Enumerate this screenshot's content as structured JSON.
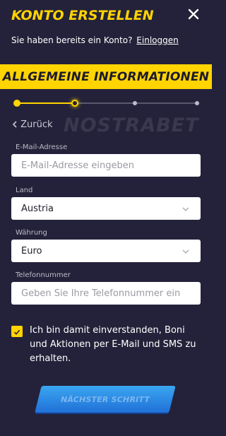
{
  "header": {
    "title": "KONTO ERSTELLEN",
    "subtitle": "Sie haben bereits ein Konto?",
    "login_link": "Einloggen"
  },
  "banner": {
    "title": "ALLGEMEINE INFORMATIONEN"
  },
  "stepper": {
    "steps": 4,
    "current_step": 2
  },
  "nav": {
    "back_label": "Zurück"
  },
  "watermark": "NOSTRABET",
  "form": {
    "email": {
      "label": "E-Mail-Adresse",
      "value": "",
      "placeholder": "E-Mail-Adresse eingeben"
    },
    "country": {
      "label": "Land",
      "value": "Austria"
    },
    "currency": {
      "label": "Währung",
      "value": "Euro"
    },
    "phone": {
      "label": "Telefonnummer",
      "value": "",
      "placeholder": "Geben Sie Ihre Telefonnummer ein"
    }
  },
  "consent": {
    "checked": true,
    "text": "Ich bin damit einverstanden, Boni und Aktionen per E-Mail und SMS zu erhalten."
  },
  "next_button": {
    "label": "NÄCHSTER SCHRITT"
  },
  "colors": {
    "accent": "#ffd400",
    "background": "#24223a",
    "button_blue": "#2b86e6"
  },
  "icons": {
    "close": "close-icon",
    "back": "chevron-left-icon",
    "dropdown": "chevron-down-icon",
    "check": "checkmark-icon"
  }
}
